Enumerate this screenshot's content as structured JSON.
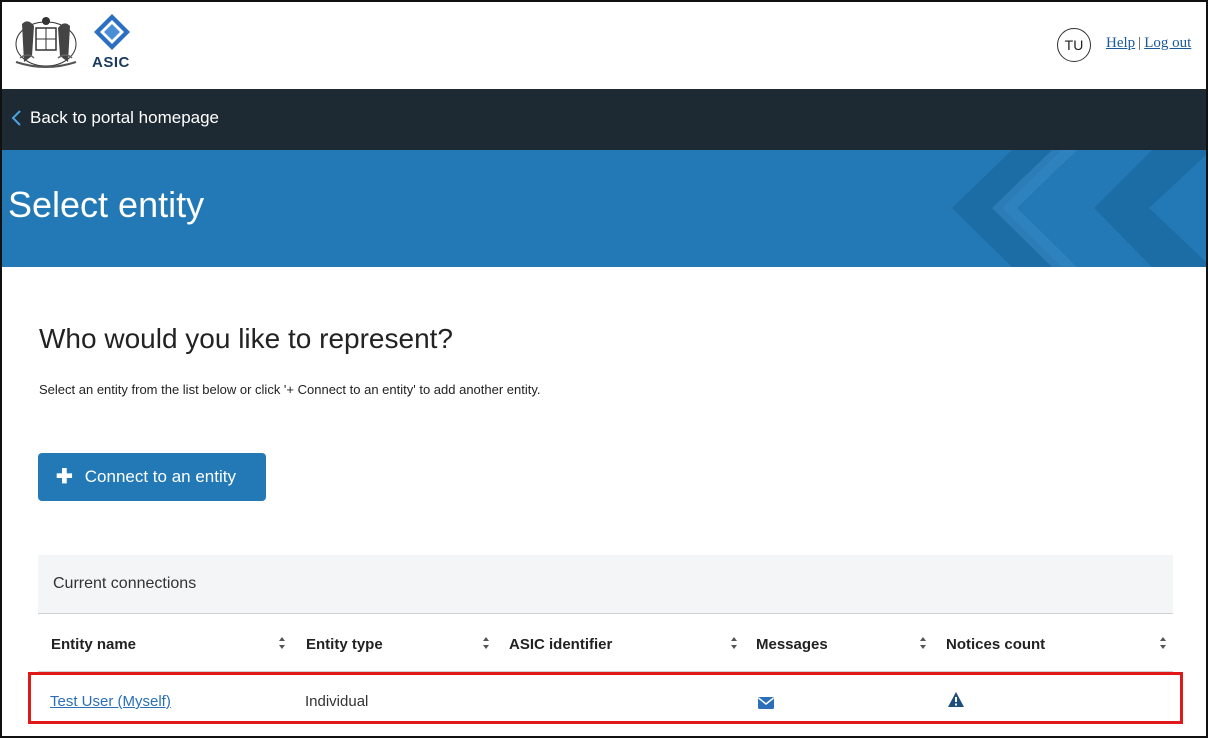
{
  "header": {
    "brand_text": "ASIC",
    "avatar_initials": "TU",
    "help_label": "Help",
    "separator": "|",
    "logout_label": "Log out"
  },
  "nav": {
    "back_label": "Back to portal homepage",
    "back_icon": "chevron-left-icon"
  },
  "banner": {
    "title": "Select entity",
    "background_color": "#2279b5"
  },
  "main": {
    "heading": "Who would you like to represent?",
    "intro": "Select an entity from the list below or click '+ Connect to an entity' to add another entity.",
    "connect_button": {
      "icon": "plus-icon",
      "label": "Connect to an entity"
    },
    "connections": {
      "title": "Current connections",
      "columns": [
        "Entity name",
        "Entity type",
        "ASIC identifier",
        "Messages",
        "Notices count"
      ],
      "rows": [
        {
          "entity_name": "Test User (Myself)",
          "entity_type": "Individual",
          "asic_identifier": "",
          "messages_icon": "envelope-icon",
          "notices_icon": "warning-icon"
        }
      ]
    }
  },
  "colors": {
    "accent": "#2279b5",
    "navbar": "#1e2a33",
    "highlight_border": "#e01818",
    "link": "#2a6fb8"
  }
}
